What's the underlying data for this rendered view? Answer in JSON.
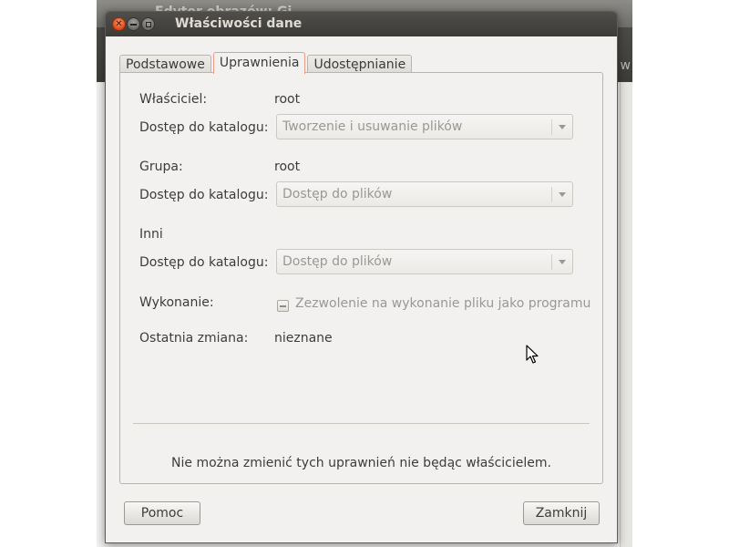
{
  "background_window": {
    "title": "Edytor obrazów: Gi",
    "toolbar_text": "w"
  },
  "dialog": {
    "title": "Właściwości dane",
    "controls": {
      "close_icon": "✕",
      "minimize_icon": "minimize-icon",
      "maximize_icon": "maximize-icon"
    }
  },
  "tabs": [
    {
      "label": "Podstawowe",
      "active": false
    },
    {
      "label": "Uprawnienia",
      "active": true
    },
    {
      "label": "Udostępnianie",
      "active": false
    }
  ],
  "permissions": {
    "owner": {
      "label": "Właściciel:",
      "value": "root",
      "access_label": "Dostęp do katalogu:",
      "access_value": "Tworzenie i usuwanie plików"
    },
    "group": {
      "label": "Grupa:",
      "value": "root",
      "access_label": "Dostęp do katalogu:",
      "access_value": "Dostęp do plików"
    },
    "others": {
      "label": "Inni",
      "access_label": "Dostęp do katalogu:",
      "access_value": "Dostęp do plików"
    },
    "execute": {
      "label": "Wykonanie:",
      "checkbox_label": "Zezwolenie na wykonanie pliku jako programu",
      "state": "inconsistent"
    },
    "last_change": {
      "label": "Ostatnia zmiana:",
      "value": "nieznane"
    },
    "notice": "Nie można zmienić tych uprawnień nie będąc właścicielem."
  },
  "buttons": {
    "help": "Pomoc",
    "close": "Zamknij"
  },
  "colors": {
    "titlebar": "#3c3b37",
    "close_button": "#df4a16",
    "active_tab_border": "#e89d86",
    "window_bg": "#f2f1f0"
  }
}
